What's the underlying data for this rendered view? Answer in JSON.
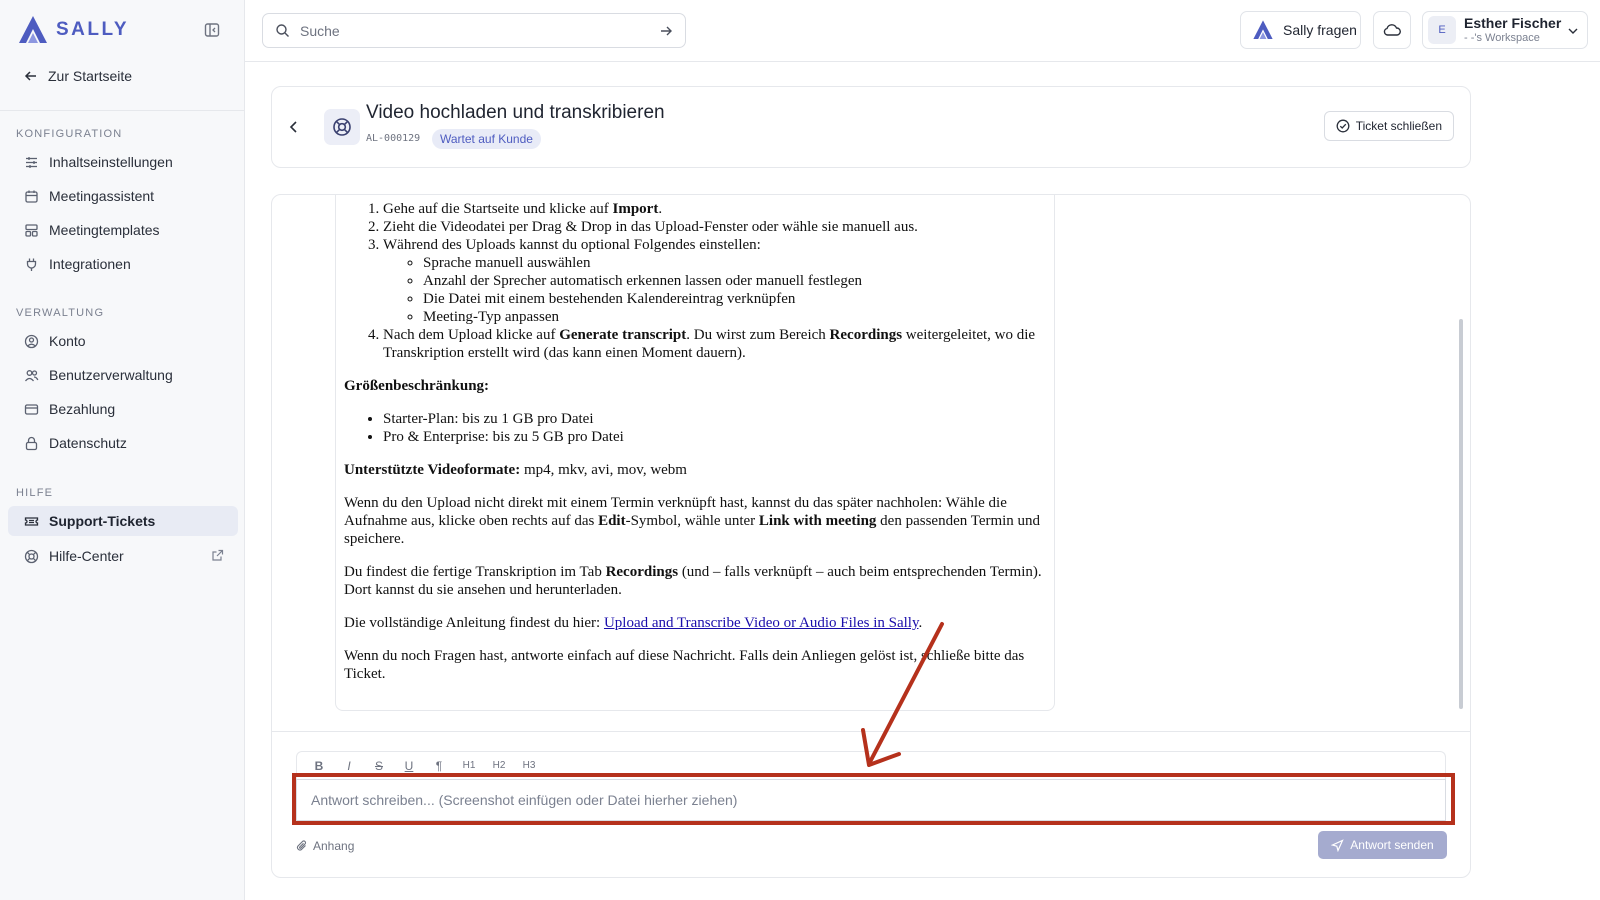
{
  "app": {
    "brand": "SALLY",
    "brand_color": "#4e5cc0"
  },
  "sidebar": {
    "back_label": "Zur Startseite",
    "sections": [
      {
        "label": "KONFIGURATION",
        "items": [
          {
            "label": "Inhaltseinstellungen",
            "icon": "sliders-icon"
          },
          {
            "label": "Meetingassistent",
            "icon": "calendar-icon"
          },
          {
            "label": "Meetingtemplates",
            "icon": "template-icon"
          },
          {
            "label": "Integrationen",
            "icon": "plug-icon"
          }
        ]
      },
      {
        "label": "VERWALTUNG",
        "items": [
          {
            "label": "Konto",
            "icon": "user-circle-icon"
          },
          {
            "label": "Benutzerverwaltung",
            "icon": "users-icon"
          },
          {
            "label": "Bezahlung",
            "icon": "credit-card-icon"
          },
          {
            "label": "Datenschutz",
            "icon": "lock-icon"
          }
        ]
      },
      {
        "label": "HILFE",
        "items": [
          {
            "label": "Support-Tickets",
            "icon": "ticket-icon",
            "active": true
          },
          {
            "label": "Hilfe-Center",
            "icon": "lifebuoy-icon",
            "external": true
          }
        ]
      }
    ]
  },
  "topbar": {
    "search_placeholder": "Suche",
    "ask_label": "Sally fragen",
    "user": {
      "initial": "E",
      "name": "Esther Fischer",
      "workspace": "- -'s Workspace"
    }
  },
  "ticket": {
    "title": "Video hochladen und transkribieren",
    "id": "AL-000129",
    "status": "Wartet auf Kunde",
    "close_label": "Ticket schließen"
  },
  "message": {
    "steps": [
      "Gehe auf die Startseite und klicke auf ",
      "Zieht die Videodatei per Drag & Drop in das Upload-Fenster oder wähle sie manuell aus.",
      "Während des Uploads kannst du optional Folgendes einstellen:",
      "Nach dem Upload klicke auf "
    ],
    "step1_bold": "Import",
    "step1_end": ".",
    "options": [
      "Sprache manuell auswählen",
      "Anzahl der Sprecher automatisch erkennen lassen oder manuell festlegen",
      "Die Datei mit einem bestehenden Kalendereintrag verknüpfen",
      "Meeting-Typ anpassen"
    ],
    "step4_bold1": "Generate transcript",
    "step4_mid": ". Du wirst zum Bereich ",
    "step4_bold2": "Recordings",
    "step4_end": " weitergeleitet, wo die Transkription erstellt wird (das kann einen Moment dauern).",
    "size_heading": "Größenbeschränkung:",
    "size_items": [
      "Starter-Plan: bis zu 1 GB pro Datei",
      "Pro & Enterprise: bis zu 5 GB pro Datei"
    ],
    "formats_bold": "Unterstützte Videoformate:",
    "formats_text": " mp4, mkv, avi, mov, webm",
    "para_link_1": "Wenn du den Upload nicht direkt mit einem Termin verknüpft hast, kannst du das später nachholen: Wähle die Aufnahme aus, klicke oben rechts auf das ",
    "para_link_bold1": "Edit",
    "para_link_2": "-Symbol, wähle unter ",
    "para_link_bold2": "Link with meeting",
    "para_link_3": " den passenden Termin und speichere.",
    "para_find_1": "Du findest die fertige Transkription im Tab ",
    "para_find_bold": "Recordings",
    "para_find_2": " (und – falls verknüpft – auch beim entsprechenden Termin). Dort kannst du sie ansehen und herunterladen.",
    "guide_text": "Die vollständige Anleitung findest du hier: ",
    "guide_link": "Upload and Transcribe Video or Audio Files in Sally",
    "guide_end": ".",
    "closing": "Wenn du noch Fragen hast, antworte einfach auf diese Nachricht. Falls dein Anliegen gelöst ist, schließe bitte das Ticket."
  },
  "reply": {
    "toolbar": [
      "B",
      "I",
      "S",
      "U",
      "¶",
      "H1",
      "H2",
      "H3"
    ],
    "placeholder": "Antwort schreiben... (Screenshot einfügen oder Datei hierher ziehen)",
    "attach_label": "Anhang",
    "send_label": "Antwort senden"
  },
  "annotation_color": "#b5311c"
}
